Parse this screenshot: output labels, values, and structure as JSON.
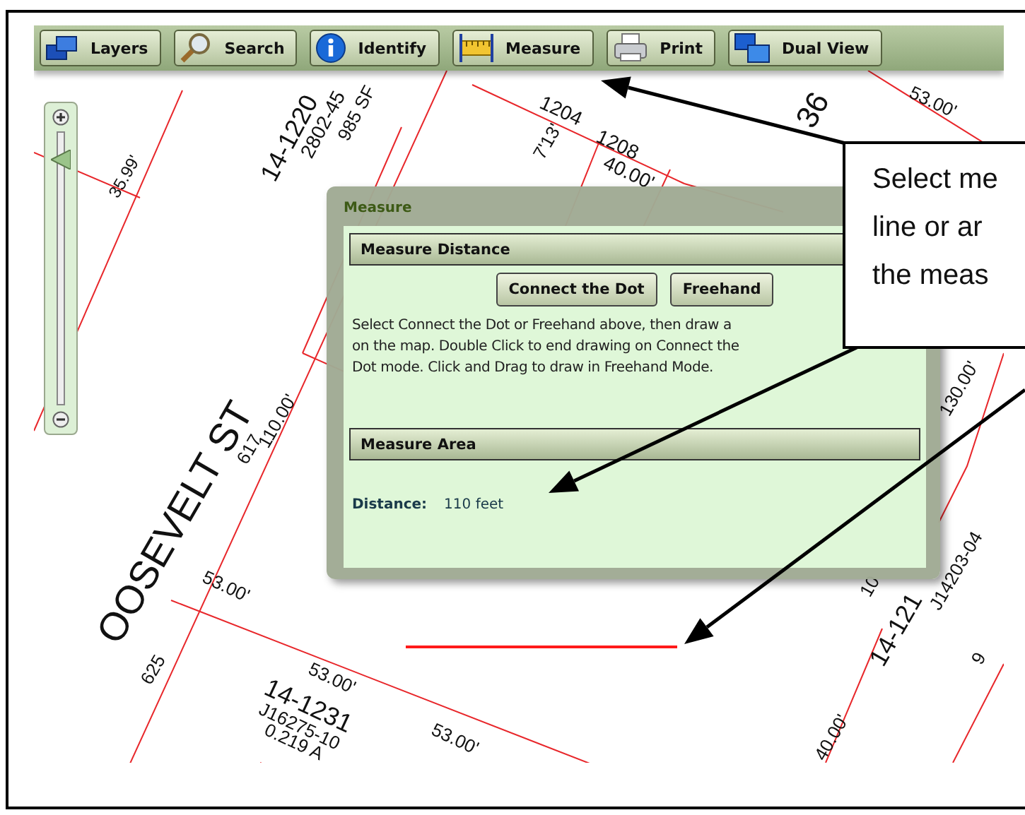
{
  "toolbar": {
    "buttons": [
      {
        "label": "Layers",
        "kind": "layers"
      },
      {
        "label": "Search",
        "kind": "search"
      },
      {
        "label": "Identify",
        "kind": "identify"
      },
      {
        "label": "Measure",
        "kind": "measure"
      },
      {
        "label": "Print",
        "kind": "print"
      },
      {
        "label": "Dual View",
        "kind": "dual"
      }
    ]
  },
  "zoom_slider": {
    "level": 0.9
  },
  "map": {
    "labels": [
      "35.99'",
      "14-1220",
      "2802-45",
      "985 SF",
      "1204",
      "1208",
      "7'13'",
      "40.00'",
      "36",
      "53.00'",
      "617",
      "110.00'",
      "OOSEVELT ST",
      "625",
      "53.00'",
      "53.00'",
      "14-1231",
      "J16275-10",
      "0.219 A",
      "53.00'",
      "130.00'",
      "10",
      "14-121",
      "J14203-04",
      "9",
      "40.00'"
    ]
  },
  "measure_panel": {
    "title": "Measure",
    "distance_section": {
      "title": "Measure Distance",
      "buttons": [
        "Connect the Dot",
        "Freehand"
      ],
      "instructions": [
        "Select Connect the Dot or Freehand above, then draw a",
        "on the map.  Double Click to end drawing on Connect the",
        "Dot mode.  Click and Drag to draw in Freehand Mode."
      ]
    },
    "area_section": {
      "title": "Measure Area"
    },
    "result": {
      "label": "Distance:",
      "value": "110 feet"
    }
  },
  "callout": {
    "lines": [
      "Select me",
      "line or ar",
      "the meas"
    ]
  }
}
